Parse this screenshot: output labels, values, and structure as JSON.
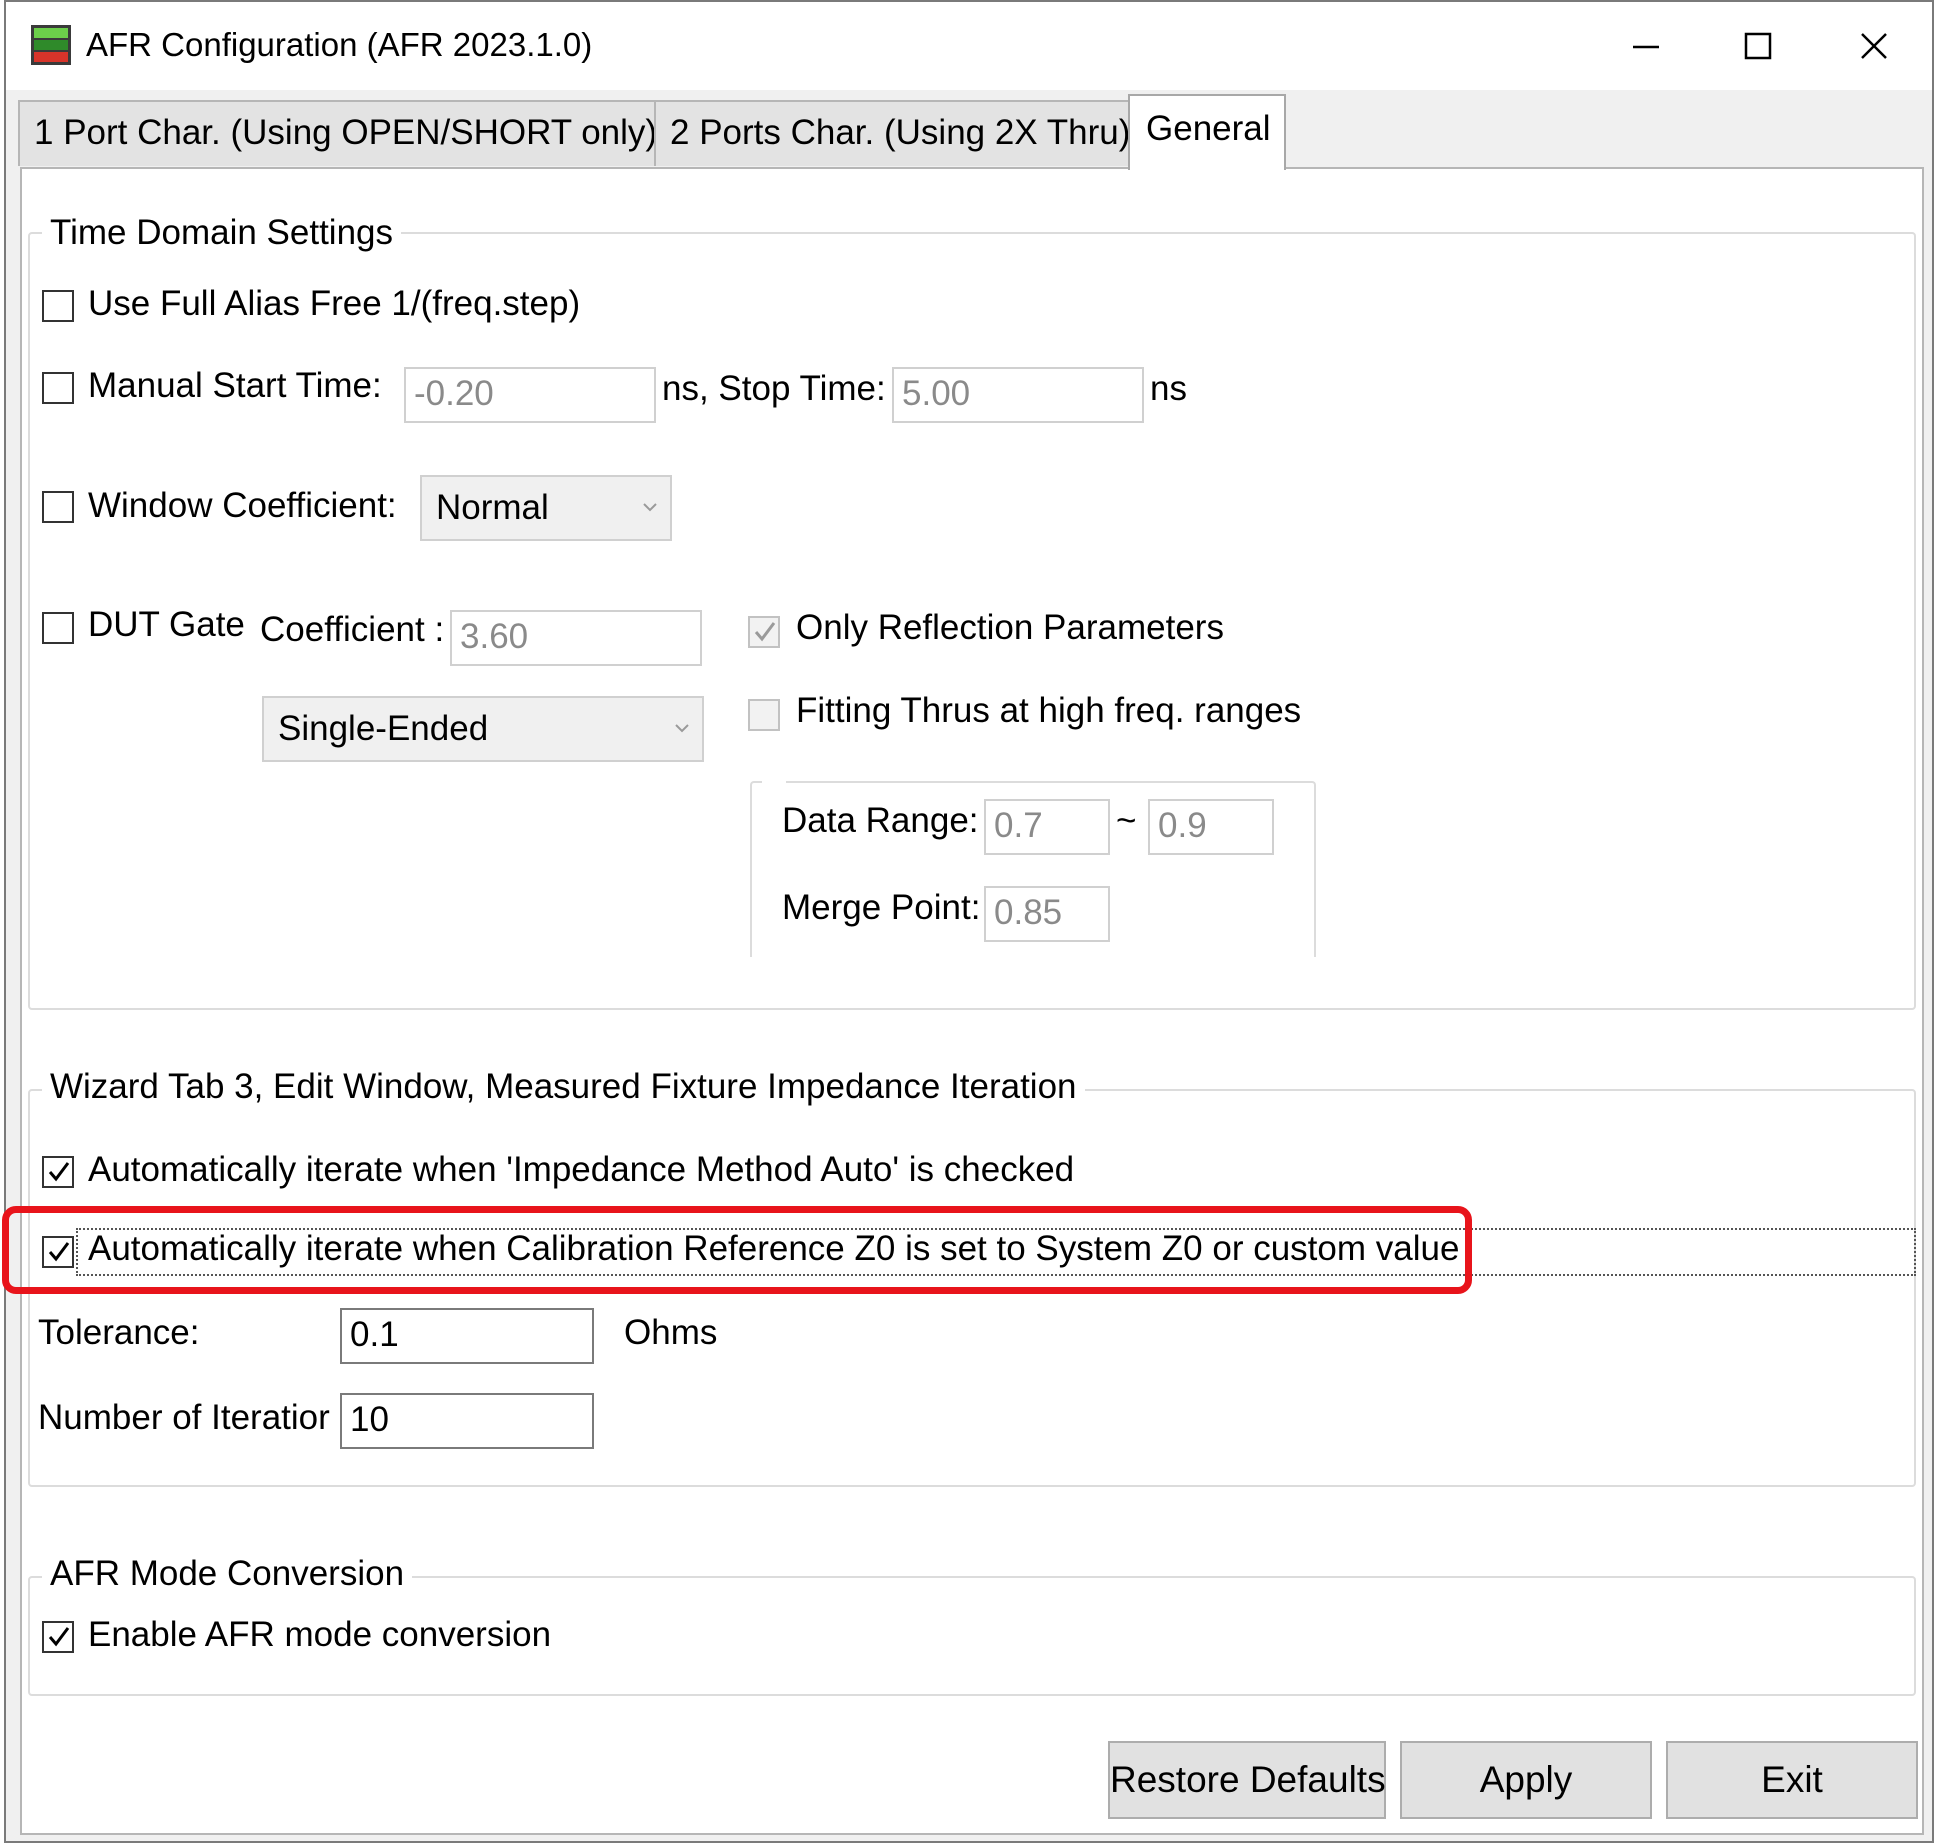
{
  "window": {
    "title": "AFR Configuration (AFR 2023.1.0)",
    "minimize_glyph": "—",
    "maximize_glyph": "☐",
    "close_glyph": "✕"
  },
  "tabs": [
    {
      "label": "1 Port Char. (Using OPEN/SHORT only)",
      "active": false
    },
    {
      "label": "2 Ports Char. (Using 2X Thru)",
      "active": false
    },
    {
      "label": "General",
      "active": true
    }
  ],
  "time_domain": {
    "legend": "Time Domain Settings",
    "alias_free_label": "Use Full Alias Free 1/(freq.step)",
    "alias_free_checked": false,
    "manual_start_label": "Manual Start Time:",
    "manual_start_checked": false,
    "start_time_value": "-0.20",
    "stop_time_label": "ns, Stop Time:",
    "stop_time_value": "5.00",
    "stop_unit": "ns",
    "window_coef_label": "Window Coefficient:",
    "window_coef_checked": false,
    "window_coef_value": "Normal",
    "dut_gate_label": "DUT Gate",
    "dut_gate_checked": false,
    "coefficient_label": "Coefficient :",
    "coefficient_value": "3.60",
    "gate_mode_value": "Single-Ended",
    "only_reflection_label": "Only Reflection Parameters",
    "only_reflection_checked": true,
    "fitting_thrus_label": "Fitting Thrus at high freq. ranges",
    "fitting_thrus_checked": false,
    "data_range_label": "Data Range:",
    "data_range_min": "0.7",
    "data_range_sep": "~",
    "data_range_max": "0.9",
    "merge_point_label": "Merge Point:",
    "merge_point_value": "0.85"
  },
  "wizard": {
    "legend": "Wizard Tab 3, Edit Window, Measured Fixture Impedance Iteration",
    "auto_iterate_label": "Automatically iterate when 'Impedance Method Auto' is checked",
    "auto_iterate_checked": true,
    "auto_iterate_z0_label": "Automatically iterate when Calibration Reference Z0 is set to System Z0 or custom value",
    "auto_iterate_z0_checked": true,
    "tolerance_label": "Tolerance:",
    "tolerance_value": "0.1",
    "tolerance_unit": "Ohms",
    "iterations_label": "Number of Iteratior",
    "iterations_value": "10"
  },
  "mode_conversion": {
    "legend": "AFR Mode Conversion",
    "enable_label": "Enable AFR mode conversion",
    "enable_checked": true
  },
  "buttons": {
    "restore_defaults": "Restore Defaults",
    "apply": "Apply",
    "exit": "Exit"
  },
  "colors": {
    "highlight": "#e8141b",
    "window_bg": "#f0f0f0",
    "panel_bg": "#ffffff"
  }
}
